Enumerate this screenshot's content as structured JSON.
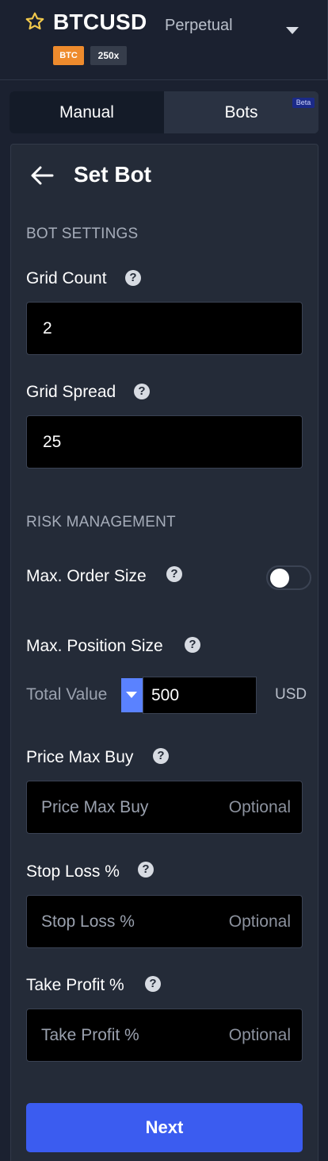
{
  "header": {
    "symbol": "BTCUSD",
    "market_type": "Perpetual",
    "asset_badge": "BTC",
    "leverage_badge": "250x"
  },
  "tabs": [
    {
      "label": "Manual",
      "active": true
    },
    {
      "label": "Bots",
      "active": false,
      "badge": "Beta"
    }
  ],
  "panel": {
    "title": "Set Bot",
    "bot_settings_section": "BOT SETTINGS",
    "grid_count": {
      "label": "Grid Count",
      "value": "2"
    },
    "grid_spread": {
      "label": "Grid Spread",
      "value": "25"
    },
    "risk_section": "RISK MANAGEMENT",
    "max_order_size": {
      "label": "Max. Order Size",
      "enabled": false
    },
    "max_position_size": {
      "label": "Max. Position Size",
      "mode_label": "Total Value",
      "value": "500",
      "unit": "USD"
    },
    "price_max_buy": {
      "label": "Price Max Buy",
      "placeholder": "Price Max Buy",
      "hint": "Optional"
    },
    "stop_loss": {
      "label": "Stop Loss %",
      "placeholder": "Stop Loss %",
      "hint": "Optional"
    },
    "take_profit": {
      "label": "Take Profit %",
      "placeholder": "Take Profit %",
      "hint": "Optional"
    },
    "next_label": "Next",
    "help_glyph": "?"
  },
  "colors": {
    "background": "#1b2130",
    "panel": "#242b38",
    "asset_badge": "#ee8b2d",
    "primary_button": "#3b5cf0",
    "dropdown_accent": "#5a82ff"
  },
  "icons": [
    "star-icon",
    "chevron-down-icon",
    "back-arrow-icon",
    "help-icon",
    "caret-down-icon"
  ]
}
